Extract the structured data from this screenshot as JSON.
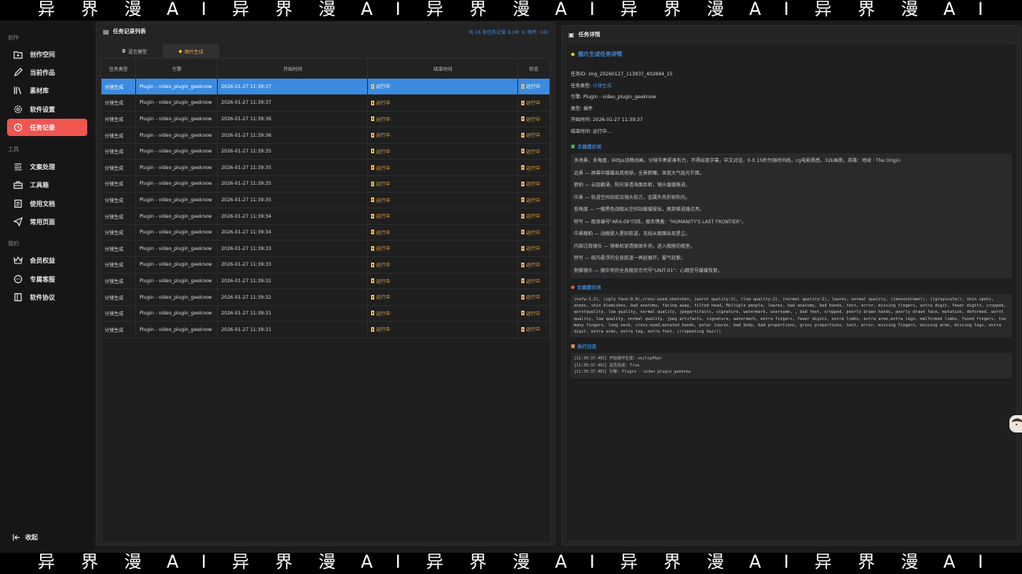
{
  "watermark": {
    "text": [
      "异",
      "界",
      "漫",
      "A",
      "I"
    ]
  },
  "sidebar": {
    "sections": [
      {
        "title": "创作",
        "items": [
          {
            "label": "创作空间",
            "icon": "folder-plus-icon"
          },
          {
            "label": "当前作品",
            "icon": "pencil-icon"
          },
          {
            "label": "素材库",
            "icon": "library-icon"
          },
          {
            "label": "软件设置",
            "icon": "gear-icon"
          },
          {
            "label": "任务记录",
            "icon": "history-icon",
            "active": true
          }
        ]
      },
      {
        "title": "工具",
        "items": [
          {
            "label": "文案处理",
            "icon": "text-edit-icon"
          },
          {
            "label": "工具箱",
            "icon": "toolbox-icon"
          },
          {
            "label": "使用文档",
            "icon": "document-icon"
          },
          {
            "label": "常用页面",
            "icon": "send-icon"
          }
        ]
      },
      {
        "title": "我的",
        "items": [
          {
            "label": "会员权益",
            "icon": "crown-icon"
          },
          {
            "label": "专属客服",
            "icon": "chat-icon"
          },
          {
            "label": "软件协议",
            "icon": "agreement-icon"
          }
        ]
      }
    ],
    "collapse_label": "收起"
  },
  "task_list": {
    "title": "任务记录列表",
    "count_text": "共 16 条任务记录 (LLM: 0, 图片: 16)",
    "tabs": [
      {
        "label": "语言模型",
        "icon": "robot-icon",
        "active": false
      },
      {
        "label": "图片生成",
        "icon": "image-icon",
        "active": true
      }
    ],
    "columns": [
      "任务类型",
      "引擎",
      "开始时间",
      "结束时间",
      "状态"
    ],
    "rows": [
      {
        "type": "分镜生成",
        "engine": "Plugin - video_plugin_geeknow",
        "start": "2026-01-27 11:39:37",
        "end": "运行中",
        "status": "运行中",
        "selected": true
      },
      {
        "type": "分镜生成",
        "engine": "Plugin - video_plugin_geeknow",
        "start": "2026-01-27 11:39:37",
        "end": "运行中",
        "status": "运行中"
      },
      {
        "type": "分镜生成",
        "engine": "Plugin - video_plugin_geeknow",
        "start": "2026-01-27 11:39:36",
        "end": "运行中",
        "status": "运行中"
      },
      {
        "type": "分镜生成",
        "engine": "Plugin - video_plugin_geeknow",
        "start": "2026-01-27 11:39:36",
        "end": "运行中",
        "status": "运行中"
      },
      {
        "type": "分镜生成",
        "engine": "Plugin - video_plugin_geeknow",
        "start": "2026-01-27 11:39:35",
        "end": "运行中",
        "status": "运行中"
      },
      {
        "type": "分镜生成",
        "engine": "Plugin - video_plugin_geeknow",
        "start": "2026-01-27 11:39:35",
        "end": "运行中",
        "status": "运行中"
      },
      {
        "type": "分镜生成",
        "engine": "Plugin - video_plugin_geeknow",
        "start": "2026-01-27 11:39:35",
        "end": "运行中",
        "status": "运行中"
      },
      {
        "type": "分镜生成",
        "engine": "Plugin - video_plugin_geeknow",
        "start": "2026-01-27 11:39:35",
        "end": "运行中",
        "status": "运行中"
      },
      {
        "type": "分镜生成",
        "engine": "Plugin - video_plugin_geeknow",
        "start": "2026-01-27 11:39:34",
        "end": "运行中",
        "status": "运行中"
      },
      {
        "type": "分镜生成",
        "engine": "Plugin - video_plugin_geeknow",
        "start": "2026-01-27 11:39:34",
        "end": "运行中",
        "status": "运行中"
      },
      {
        "type": "分镜生成",
        "engine": "Plugin - video_plugin_geeknow",
        "start": "2026-01-27 11:39:33",
        "end": "运行中",
        "status": "运行中"
      },
      {
        "type": "分镜生成",
        "engine": "Plugin - video_plugin_geeknow",
        "start": "2026-01-27 11:39:33",
        "end": "运行中",
        "status": "运行中"
      },
      {
        "type": "分镜生成",
        "engine": "Plugin - video_plugin_geeknow",
        "start": "2026-01-27 11:39:32",
        "end": "运行中",
        "status": "运行中"
      },
      {
        "type": "分镜生成",
        "engine": "Plugin - video_plugin_geeknow",
        "start": "2026-01-27 11:39:32",
        "end": "运行中",
        "status": "运行中"
      },
      {
        "type": "分镜生成",
        "engine": "Plugin - video_plugin_geeknow",
        "start": "2026-01-27 11:39:31",
        "end": "运行中",
        "status": "运行中"
      },
      {
        "type": "分镜生成",
        "engine": "Plugin - video_plugin_geeknow",
        "start": "2026-01-27 11:39:31",
        "end": "运行中",
        "status": "运行中"
      }
    ]
  },
  "detail": {
    "title": "任务详情",
    "heading": "图片生成任务详情",
    "meta": [
      {
        "k": "任务ID: ",
        "v": "img_20260127_113937_402694_15"
      },
      {
        "k": "任务类型: ",
        "v": "分镜生成",
        "blue": true
      },
      {
        "k": "引擎: ",
        "v": "Plugin - video_plugin_geeknow"
      },
      {
        "k": "类型: ",
        "v": "插件"
      },
      {
        "k": "开始时间: ",
        "v": "2026-01-27 11:39:37"
      },
      {
        "k": "结束时间: ",
        "v": "运行中..."
      }
    ],
    "positive_title": "正面提示词",
    "positive_lines": [
      "多场景，多角度，60fps流畅动画，分镜节奏紧凑有力，不得出现字幕，中文对话，0-0.15秒为强时间线，cg电影质感，32k画质，英雄：地球 · The Origin",
      "远景 — 屏幕中缓缓出现地球，全景俯瞰，显现大气层光芒面。",
      "俯拍 — 云层翻涌，阳光穿透海面反射，镜头缓缓推进。",
      "中景 — 轨道空间站前沿镜头前方，金属外壳折射阳光。",
      "低角度 — 一艘黑色战舰从空间站缓缓驶出，尾部推进器点亮。",
      "特写 — 舰身编号\"ARX-09\"闪烁，舰名镌着：\"HUMANITY'S LAST FRONTIER\"。",
      "中景跟拍 — 战舰驶入星际航道，无线从舰面出现星尘。",
      "内部过肩镜头 — 镜框机穿透舰体外壳，进入舰舱的舰室。",
      "特写 — 舷内悬浮的全息航道一再延展开，雾气轻萦。",
      "侧推镜头 — 舰中央的全息舰员示代号\"UNIT-01\"：心跳信号缓缓恢复。"
    ],
    "negative_title": "负面提示词",
    "negative_text": "(nsfw:1.5), (ugly face:0.8),cross-eyed,sketches, (worst quality:2), (low quality:2), (normal quality:2), lowres, normal quality, ((monochrome)), ((grayscale)), skin spots, acnes, skin blemishes, bad anatomy, facing away, tilted head, Multiple people, lowres, bad anatomy, bad hands, text, error, missing fingers, extra digit, fewer digits, cropped, worstquality, low quality, normal quality, jpegartifacts, signature, watermark, username, , bad feet, cropped, poorly drawn hands, poorly drawn face, mutation, deformed, worst quality, low quality, normal quality, jpeg artifacts, signature, watermark, extra fingers, fewer digits, extra limbs, extra arms,extra legs, malformed limbs, fused fingers, too many fingers, long neck, cross-eyed,mutated hands, polar lowres, bad body, bad proportions, gross proportions, text, error, missing fingers, missing arms, missing legs, extra digit, extra arms, extra leg, extra foot, ((repeating hair))",
    "log_title": "执行日志",
    "log_lines": [
      "[11:39:37.402] 开始操作生成: vejlcg45pv",
      "[11:39:37.402] 是否完成: True",
      "[11:39:37.402] 引擎: Plugin - video_plugin_geeknow"
    ]
  }
}
